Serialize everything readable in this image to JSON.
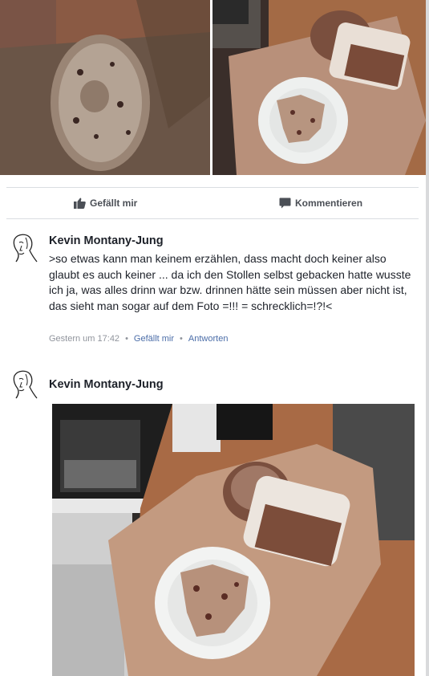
{
  "actions": {
    "like_label": "Gefällt mir",
    "comment_label": "Kommentieren"
  },
  "comment": {
    "author": "Kevin Montany-Jung",
    "text": ">so etwas kann man keinem erzählen, dass macht doch keiner also glaubt es auch keiner ... da ich den Stollen  selbst gebacken hatte wusste ich ja, was alles drinn war bzw. drinnen hätte sein müssen aber nicht ist, das sieht man sogar auf dem Foto =!!! = schrecklich=!?!<",
    "time": "Gestern um 17:42",
    "like_link": "Gefällt mir",
    "reply_link": "Antworten"
  },
  "reply": {
    "author": "Kevin Montany-Jung"
  },
  "icons": {
    "like": "thumbs-up-icon",
    "comment": "speech-bubble-icon",
    "avatar": "sketch-face-avatar"
  },
  "colors": {
    "link": "#4b6da8",
    "meta": "#90949c",
    "action_text": "#4b4f56",
    "divider": "#dadde1"
  }
}
